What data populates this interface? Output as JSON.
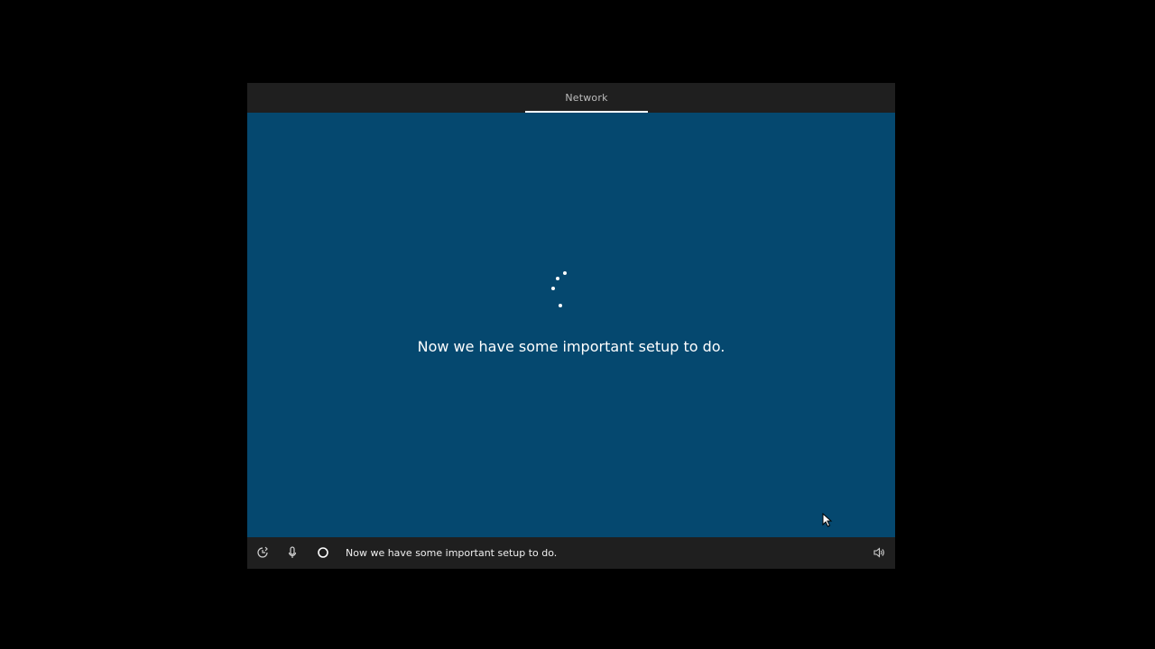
{
  "header": {
    "active_tab": "Network"
  },
  "main": {
    "message": "Now we have some important setup to do."
  },
  "footer": {
    "caption": "Now we have some important setup to do.",
    "icons": [
      "ease-of-access-icon",
      "microphone-icon",
      "cortana-icon",
      "volume-icon"
    ]
  },
  "colors": {
    "background": "#000000",
    "frame": "#1f1f1f",
    "content": "#05486f",
    "text": "#ffffff"
  }
}
